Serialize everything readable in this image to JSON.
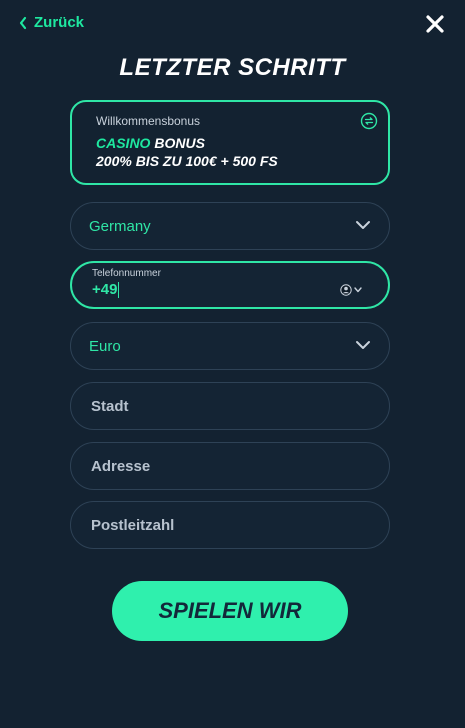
{
  "header": {
    "back_label": "Zurück",
    "title": "LETZTER SCHRITT"
  },
  "bonus": {
    "label": "Willkommensbonus",
    "accent_word": "CASINO",
    "bonus_word": " BONUS",
    "offer": "200% BIS ZU 100€ + 500 FS"
  },
  "form": {
    "country": "Germany",
    "phone_label": "Telefonnummer",
    "phone_value": "+49",
    "currency": "Euro",
    "city_placeholder": "Stadt",
    "address_placeholder": "Adresse",
    "zip_placeholder": "Postleitzahl"
  },
  "cta": {
    "label": "SPIELEN WIR"
  },
  "colors": {
    "accent": "#2fe6a6",
    "background": "#132231",
    "field_border": "#2e4256"
  },
  "icons": [
    "chevron-left-icon",
    "close-icon",
    "swap-icon",
    "chevron-down-icon",
    "flag-icon"
  ]
}
